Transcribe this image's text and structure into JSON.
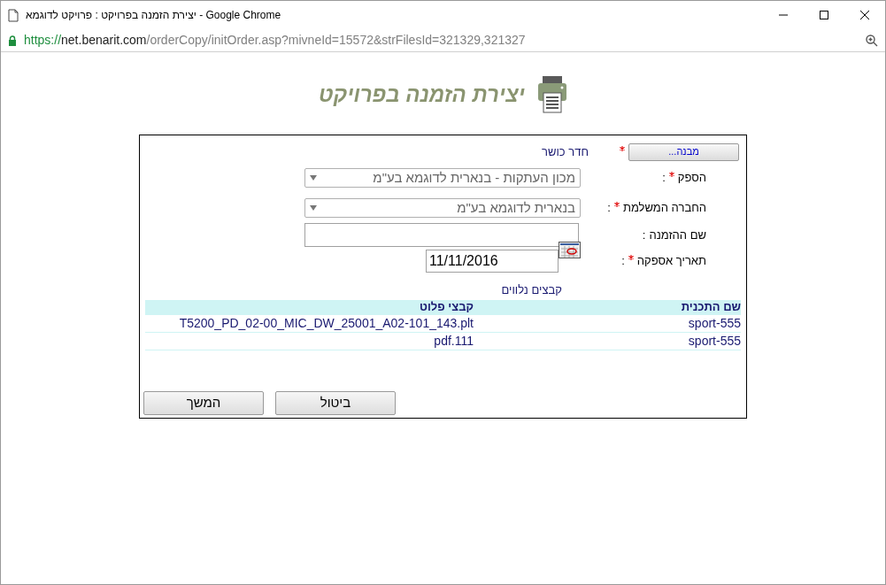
{
  "window": {
    "title": "יצירת הזמנה בפרויקט : פרויקט לדוגמא - Google Chrome"
  },
  "address_bar": {
    "scheme": "https://",
    "host": "net.benarit.com",
    "path": "/orderCopy/initOrder.asp?mivneId=15572&strFilesId=321329,321327"
  },
  "page": {
    "heading": "יצירת הזמנה בפרויקט"
  },
  "form": {
    "fields": [
      {
        "kind": "picker",
        "button": "מבנה...",
        "required": true,
        "value": "חדר כושר"
      },
      {
        "kind": "select",
        "label": "הספק",
        "required": true,
        "colon": ":",
        "value": "מכון העתקות - בנארית לדוגמא בע\"מ"
      },
      {
        "kind": "select",
        "label": "החברה המשלמת",
        "required": true,
        "colon": ":",
        "value": "בנארית לדוגמא בע\"מ"
      },
      {
        "kind": "text",
        "label": "שם ההזמנה",
        "required": false,
        "colon": ":"
      },
      {
        "kind": "date",
        "label": "תאריך אספקה",
        "required": true,
        "colon": ":",
        "value": "11/11/2016"
      }
    ]
  },
  "attachments": {
    "caption": "קבצים נלווים",
    "columns": [
      "שם התכנית",
      "קבצי פלוט"
    ],
    "rows": [
      [
        "sport-555",
        "T5200_PD_02-00_MIC_DW_25001_A02-101_143.plt"
      ],
      [
        "sport-555",
        "pdf.111"
      ]
    ]
  },
  "buttons": [
    {
      "label": "ביטול"
    },
    {
      "label": "המשך"
    }
  ]
}
